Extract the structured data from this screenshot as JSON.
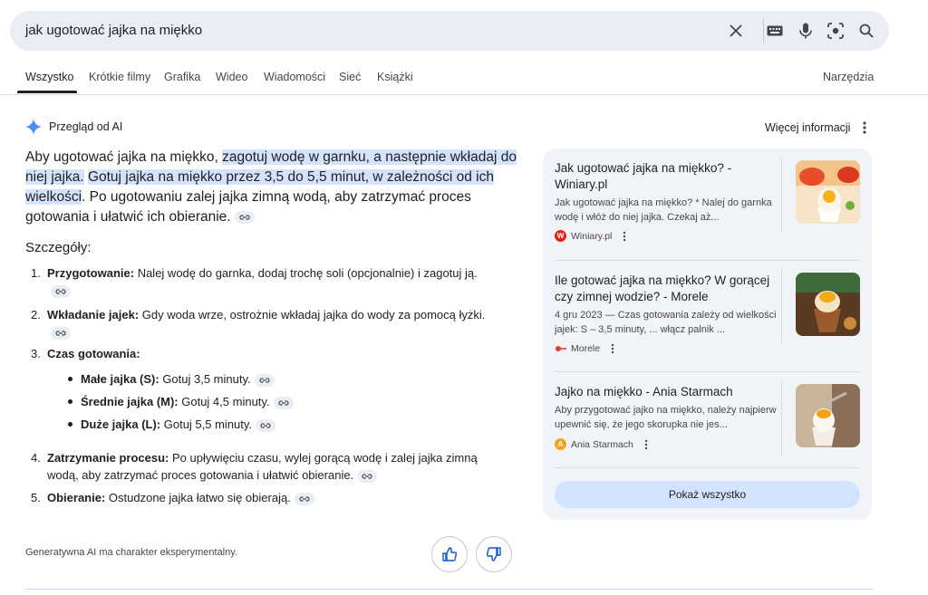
{
  "search": {
    "query": "jak ugotować jajka na miękko",
    "icons": [
      "close-icon",
      "keyboard-icon",
      "mic-icon",
      "lens-icon",
      "search-icon"
    ]
  },
  "tabs": [
    {
      "label": "Wszystko",
      "active": true
    },
    {
      "label": "Krótkie filmy"
    },
    {
      "label": "Grafika"
    },
    {
      "label": "Wideo"
    },
    {
      "label": "Wiadomości"
    },
    {
      "label": "Sieć"
    },
    {
      "label": "Książki"
    }
  ],
  "tools_label": "Narzędzia",
  "ai": {
    "header": "Przegląd od AI",
    "more_info": "Więcej informacji",
    "summary": {
      "part1": "Aby ugotować jajka na miękko, ",
      "hl1": "zagotuj wodę w garnku, a następnie wkładaj do niej jajka.",
      "space": " ",
      "hl2": "Gotuj jajka na miękko przez 3,5 do 5,5 minut, w zależności od ich wielkości",
      "part2": ". Po ugotowaniu zalej jajka zimną wodą, aby zatrzymać proces gotowania i ułatwić ich obieranie."
    },
    "details_title": "Szczegóły:",
    "items": [
      {
        "num": "1.",
        "bold": "Przygotowanie:",
        "text": " Nalej wodę do garnka, dodaj trochę soli (opcjonalnie) i zagotuj ją."
      },
      {
        "num": "2.",
        "bold": "Wkładanie jajek:",
        "text": " Gdy woda wrze, ostrożnie wkładaj jajka do wody za pomocą łyżki."
      },
      {
        "num": "3.",
        "bold": "Czas gotowania:",
        "text": ""
      },
      {
        "num": "4.",
        "bold": "Zatrzymanie procesu:",
        "text": " Po upływięciu czasu, wylej gorącą wodę i zalej jajka zimną wodą, aby zatrzymać proces gotowania i ułatwić obieranie."
      },
      {
        "num": "5.",
        "bold": "Obieranie:",
        "text": " Ostudzone jajka łatwo się obierają."
      }
    ],
    "subitems": [
      {
        "bold": "Małe jajka (S):",
        "text": " Gotuj 3,5 minuty."
      },
      {
        "bold": "Średnie jajka (M):",
        "text": " Gotuj 4,5 minuty."
      },
      {
        "bold": "Duże jajka (L):",
        "text": " Gotuj 5,5 minuty."
      }
    ],
    "disclaimer": "Generatywna AI ma charakter eksperymentalny."
  },
  "sources": [
    {
      "title": "Jak ugotować jajka na miękko? - Winiary.pl",
      "snippet": "Jak ugotować jajka na miękko? * Nalej do garnka wodę i włóż do niej jajka. Czekaj aż...",
      "site": "Winiary.pl",
      "favicon_letter": "W",
      "favicon_color": "#e2231a"
    },
    {
      "title": "Ile gotować jajka na miękko? W gorącej czy zimnej wodzie? - Morele",
      "snippet": "4 gru 2023 — Czas gotowania zależy od wielkości jajek: S – 3,5 minuty, ... włącz palnik ...",
      "site": "Morele",
      "favicon_letter": "",
      "favicon_color": "#e03c31"
    },
    {
      "title": "Jajko na miękko - Ania Starmach",
      "snippet": "Aby przygotować jajko na miękko, należy najpierw upewnić się, że jego skorupka nie jes...",
      "site": "Ania Starmach",
      "favicon_letter": "A",
      "favicon_color": "#f2a31b"
    }
  ],
  "show_all": "Pokaż wszystko",
  "colors": {
    "accent": "#0b57d0",
    "highlight": "#d3e3fd",
    "panel": "#f0f4f9",
    "searchbar": "#e9eef6"
  }
}
